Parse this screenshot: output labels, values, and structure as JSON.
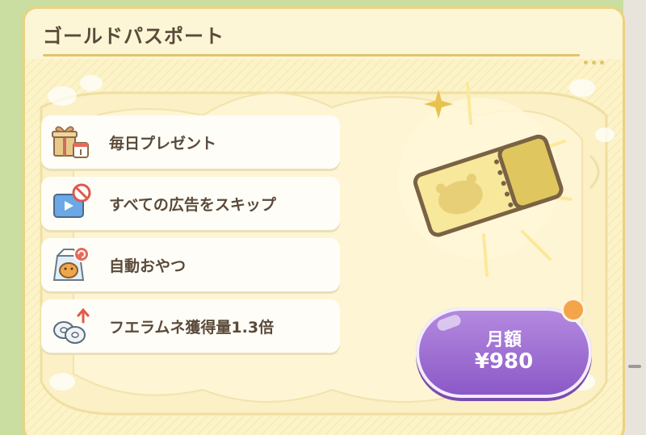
{
  "dialog": {
    "title": "ゴールドパスポート"
  },
  "features": [
    {
      "icon": "gift-calendar-icon",
      "label": "毎日プレゼント"
    },
    {
      "icon": "skip-ads-icon",
      "label": "すべての広告をスキップ"
    },
    {
      "icon": "auto-snack-icon",
      "label": "自動おやつ"
    },
    {
      "icon": "ramune-boost-icon",
      "label": "フエラムネ獲得量1.3倍"
    }
  ],
  "purchase": {
    "period": "月額",
    "price": "¥980"
  },
  "colors": {
    "panel_bg": "#fcf3c8",
    "panel_border": "#ecd27e",
    "text": "#5a4a3a",
    "button": "#9566cf",
    "notify": "#f4a44a"
  }
}
